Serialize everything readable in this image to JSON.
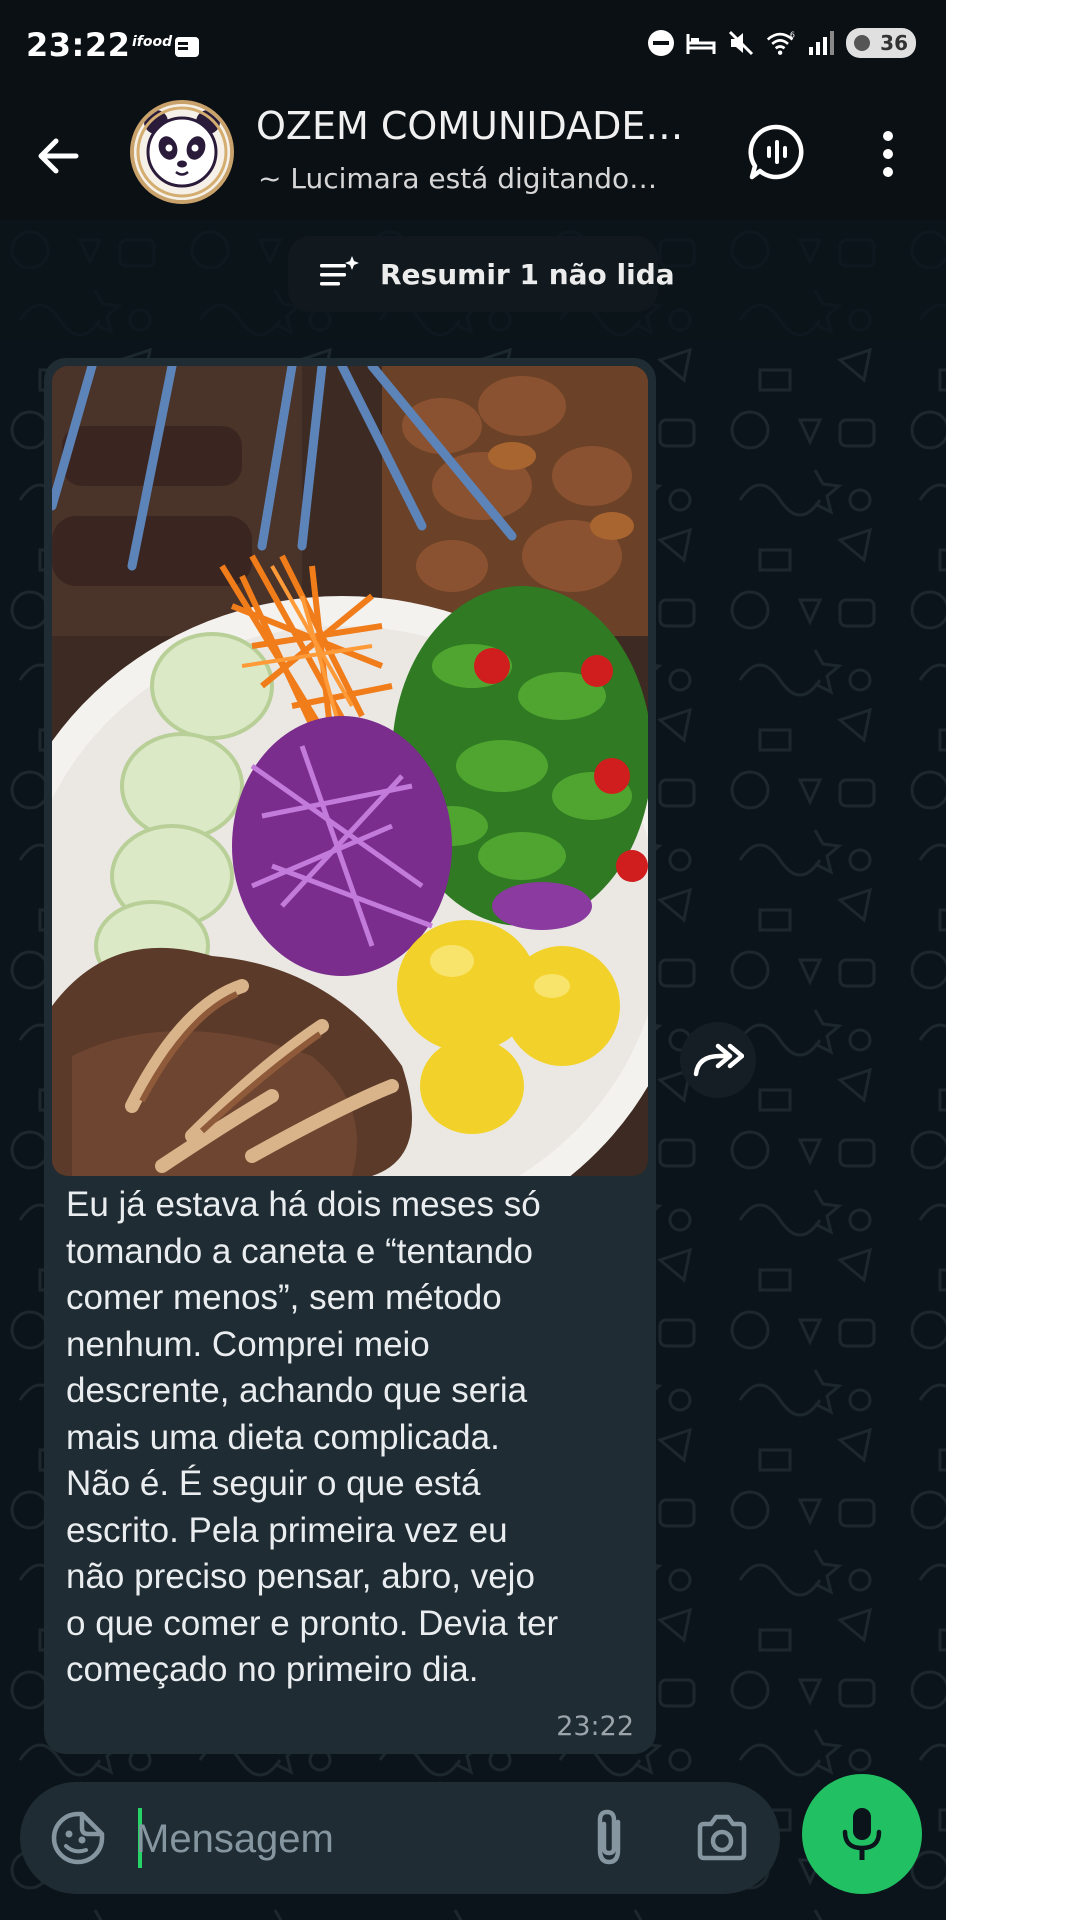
{
  "status_bar": {
    "time": "23:22",
    "app_badge": "ifood",
    "battery_level": "36",
    "icons": [
      "dnd-icon",
      "bed-icon",
      "mute-icon",
      "wifi-6-icon",
      "signal-icon",
      "battery-icon"
    ]
  },
  "header": {
    "title": "OZEM COMUNIDADE…",
    "subtitle": "~ Lucimara está digitando…"
  },
  "summary": {
    "label": "Resumir 1 não lida"
  },
  "message": {
    "text": "Eu já estava há dois meses só\ntomando a caneta e “tentando\ncomer menos”, sem método\nnenhum. Comprei meio\ndescrente, achando que seria\nmais uma dieta complicada.\nNão é. É seguir o que está\nescrito. Pela primeira vez eu\nnão preciso pensar, abro, vejo\no que comer e pronto. Devia ter\ncomeçado no primeiro dia.",
    "time": "23:22"
  },
  "composer": {
    "placeholder": "Mensagem"
  },
  "colors": {
    "background": "#0b141a",
    "bubble": "#202c33",
    "accent_green": "#21c063"
  }
}
